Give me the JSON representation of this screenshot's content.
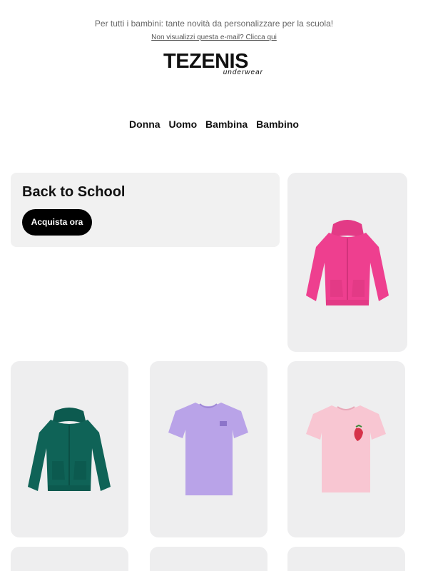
{
  "header": {
    "preheader": "Per tutti i bambini: tante novità da personalizzare per la scuola!",
    "web_version_link": "Non visualizzi questa e-mail? Clicca qui",
    "logo_main": "TEZENIS",
    "logo_sub": "underwear"
  },
  "nav": {
    "items": [
      "Donna",
      "Uomo",
      "Bambina",
      "Bambino"
    ]
  },
  "hero": {
    "title": "Back to School",
    "cta_label": "Acquista ora"
  },
  "products": [
    {
      "name": "pink-zip-hoodie",
      "color": "#ee3f8f"
    },
    {
      "name": "green-zip-hoodie",
      "color": "#0f6357"
    },
    {
      "name": "lilac-tshirt",
      "color": "#b9a3e8"
    },
    {
      "name": "pink-strawberry-tshirt",
      "color": "#f8c6d2"
    }
  ],
  "colors": {
    "card_bg": "#eeeeef",
    "cta_bg": "#000000",
    "cta_text": "#ffffff"
  }
}
